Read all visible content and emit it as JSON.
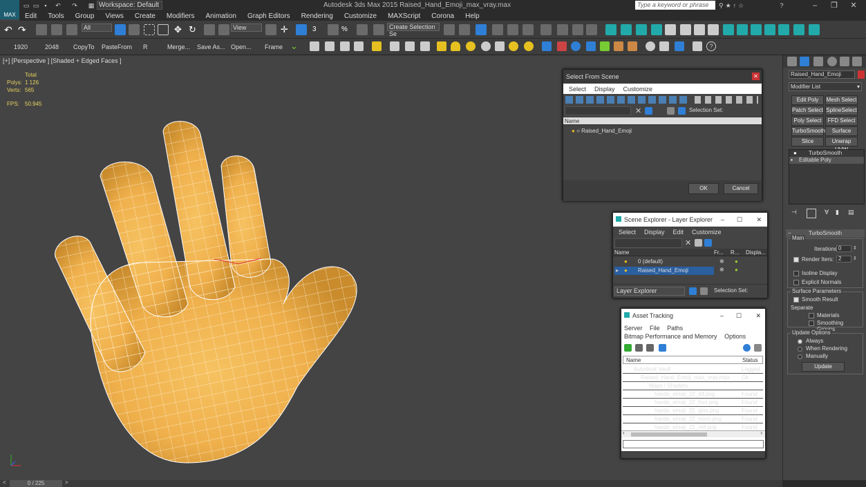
{
  "app": {
    "logo": "MAX",
    "title": "Autodesk 3ds Max  2015    Raised_Hand_Emoji_max_vray.max",
    "workspace": "Workspace: Default",
    "search_placeholder": "Type a keyword or phrase"
  },
  "menu": [
    "Edit",
    "Tools",
    "Group",
    "Views",
    "Create",
    "Modifiers",
    "Animation",
    "Graph Editors",
    "Rendering",
    "Customize",
    "MAXScript",
    "Corona",
    "Help"
  ],
  "toolbar1": {
    "selection_filter": "All",
    "ref_coord": "View",
    "named_selection": "Create Selection Se"
  },
  "toolbar2": {
    "labels": [
      "1920",
      "2048",
      "CopyTo",
      "PasteFrom",
      "R",
      "Merge...",
      "Save As...",
      "Open...",
      "Frame"
    ]
  },
  "viewport": {
    "label": "[+] [Perspective ] [Shaded + Edged Faces ]",
    "stats": {
      "total_label": "Total",
      "polys_label": "Polys:",
      "polys_value": "1 126",
      "verts_label": "Verts:",
      "verts_value": "565",
      "fps_label": "FPS:",
      "fps_value": "50.945"
    }
  },
  "select_from_scene": {
    "title": "Select From Scene",
    "menu": [
      "Select",
      "Display",
      "Customize"
    ],
    "selection_set_label": "Selection Set:",
    "column_name": "Name",
    "items": [
      "Raised_Hand_Emoji"
    ],
    "ok": "OK",
    "cancel": "Cancel"
  },
  "scene_explorer": {
    "title": "Scene Explorer - Layer Explorer",
    "menu": [
      "Select",
      "Display",
      "Edit",
      "Customize"
    ],
    "columns": [
      "Name",
      "Fr...",
      "R...",
      "Displa..."
    ],
    "rows": [
      "0 (default)",
      "Raised_Hand_Emoji"
    ],
    "footer_dropdown": "Layer Explorer",
    "selection_set_label": "Selection Set:"
  },
  "asset_tracking": {
    "title": "Asset Tracking",
    "menu": [
      "Server",
      "File",
      "Paths"
    ],
    "menu2": [
      "Bitmap Performance and Memory",
      "Options"
    ],
    "columns": [
      "Name",
      "Status"
    ],
    "rows": [
      {
        "name": "Autodesk Vault",
        "status": "Logged"
      },
      {
        "name": "Raised_Hand_Emoji_max_vray.max",
        "status": "Ok"
      },
      {
        "name": "Maps / Shaders",
        "status": ""
      },
      {
        "name": "hands_emoji_22_dif.png",
        "status": "Found"
      },
      {
        "name": "hands_emoji_22_fres.png",
        "status": "Found"
      },
      {
        "name": "hands_emoji_22_glos.png",
        "status": "Found"
      },
      {
        "name": "hands_emoji_22_norm.png",
        "status": "Found"
      },
      {
        "name": "hands_emoji_22_refl.png",
        "status": "Found"
      }
    ]
  },
  "command_panel": {
    "object_name": "Raised_Hand_Emoji",
    "modifier_list": "Modifier List",
    "buttons": [
      "Edit Poly",
      "Mesh Select",
      "Patch Select",
      "SplineSelect",
      "Poly Select",
      "FFD Select",
      "TurboSmooth",
      "Surface Select",
      "Slice",
      "Unwrap UVW"
    ],
    "stack": [
      "TurboSmooth",
      "Editable Poly"
    ],
    "rollout_title": "TurboSmooth",
    "main_label": "Main",
    "iterations_label": "Iterations:",
    "iterations_value": "0",
    "render_iters_label": "Render Iters:",
    "render_iters_value": "2",
    "isoline_label": "Isoline Display",
    "explicit_label": "Explicit Normals",
    "surface_params_label": "Surface Parameters",
    "smooth_result_label": "Smooth Result",
    "separate_label": "Separate",
    "materials_label": "Materials",
    "smoothing_groups_label": "Smoothing Groups",
    "update_options_label": "Update Options",
    "always_label": "Always",
    "when_rendering_label": "When Rendering",
    "manually_label": "Manually",
    "update_button": "Update"
  },
  "status": {
    "frame": "0 / 225"
  }
}
